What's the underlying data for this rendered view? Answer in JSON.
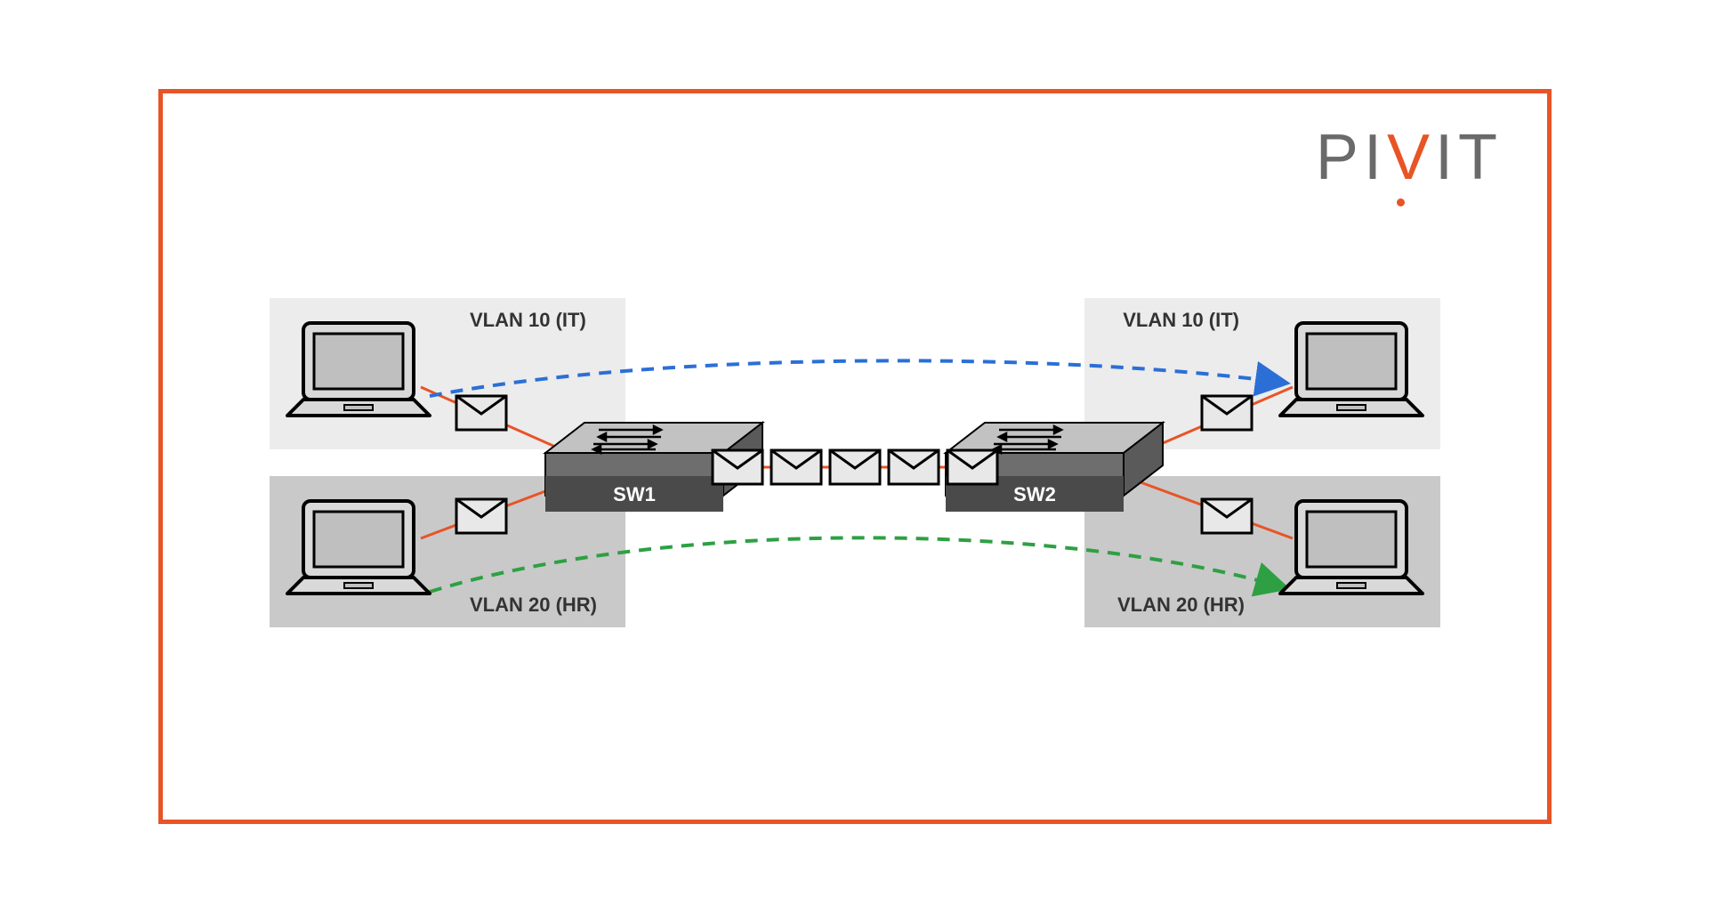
{
  "brand": {
    "name": "PIVIT"
  },
  "vlans": {
    "top": {
      "left_label": "VLAN 10 (IT)",
      "right_label": "VLAN 10 (IT)"
    },
    "bottom": {
      "left_label": "VLAN 20 (HR)",
      "right_label": "VLAN 20 (HR)"
    }
  },
  "switches": {
    "left": "SW1",
    "right": "SW2"
  },
  "colors": {
    "border": "#e85426",
    "link": "#e85426",
    "vlan_top_path": "#2b6fd6",
    "vlan_bottom_path": "#2ea043",
    "box_light": "#ececec",
    "box_dark": "#c9c9c9",
    "switch_body": "#6e6e6e",
    "switch_top": "#c2c2c2",
    "switch_label_bg": "#4a4a4a"
  }
}
